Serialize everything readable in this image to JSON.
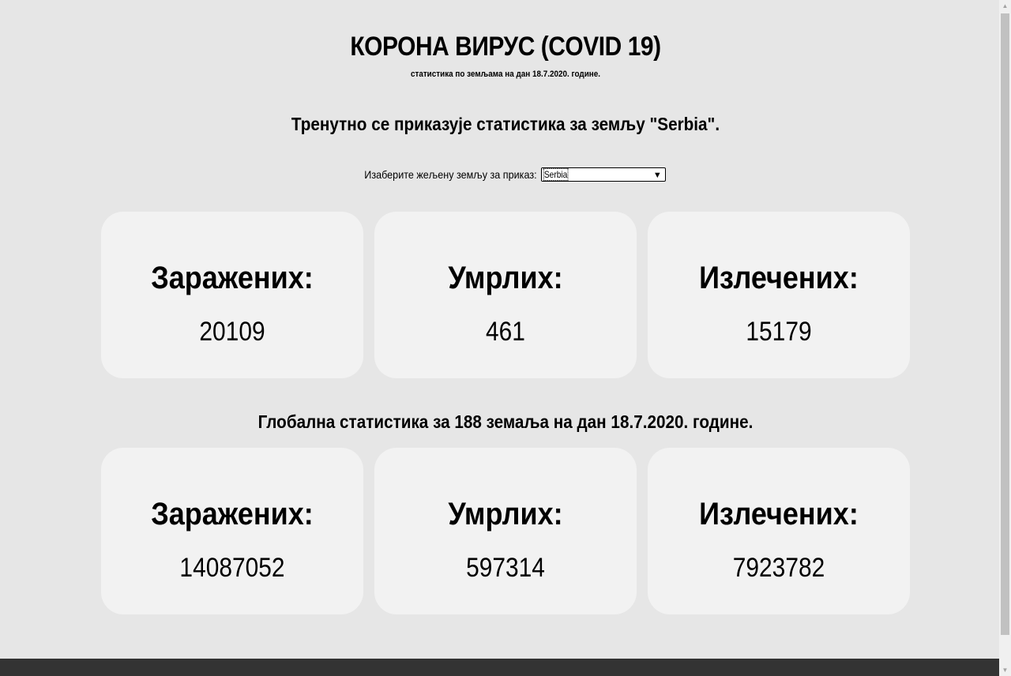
{
  "header": {
    "title": "КОРОНА ВИРУС (COVID 19)",
    "subtitle": "статистика по земљама на дан 18.7.2020. године."
  },
  "current_country": {
    "text": "Тренутно се приказује статистика за земљу \"Serbia\".",
    "selector_label": "Изаберите жељену земљу за приказ:",
    "selected": "Serbia"
  },
  "country_stats": [
    {
      "label": "Заражених:",
      "value": "20109"
    },
    {
      "label": "Умрлих:",
      "value": "461"
    },
    {
      "label": "Излечених:",
      "value": "15179"
    }
  ],
  "global": {
    "heading": "Глобална статистика за 188 земаља на дан 18.7.2020. године.",
    "stats": [
      {
        "label": "Заражених:",
        "value": "14087052"
      },
      {
        "label": "Умрлих:",
        "value": "597314"
      },
      {
        "label": "Излечених:",
        "value": "7923782"
      }
    ]
  },
  "icons": {
    "select_arrow": "▼",
    "scroll_up": "▲",
    "scroll_down": "▼"
  },
  "colors": {
    "background": "#e6e6e6",
    "card": "#f2f2f2",
    "footer": "#333333"
  }
}
